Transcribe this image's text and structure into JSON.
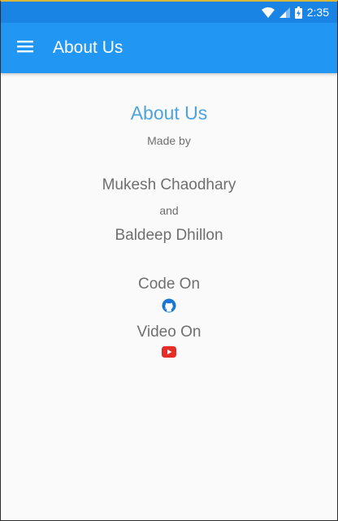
{
  "status_bar": {
    "time": "2:35",
    "icons": [
      "wifi-icon",
      "cell-signal-icon",
      "battery-icon"
    ]
  },
  "app_bar": {
    "menu_icon": "hamburger-menu-icon",
    "title": "About Us"
  },
  "content": {
    "heading": "About Us",
    "made_by": "Made by",
    "author_1": "Mukesh Chaodhary",
    "conjunction": "and",
    "author_2": "Baldeep Dhillon",
    "code_on": "Code  On",
    "code_icon": "github-icon",
    "video_on": "Video On",
    "video_icon": "youtube-icon"
  },
  "colors": {
    "status_bar": "#1a84e4",
    "app_bar": "#2196f3",
    "heading": "#4ea4dc",
    "body_text": "#6f6f6f",
    "github": "#1976d2",
    "youtube": "#e52d27"
  }
}
